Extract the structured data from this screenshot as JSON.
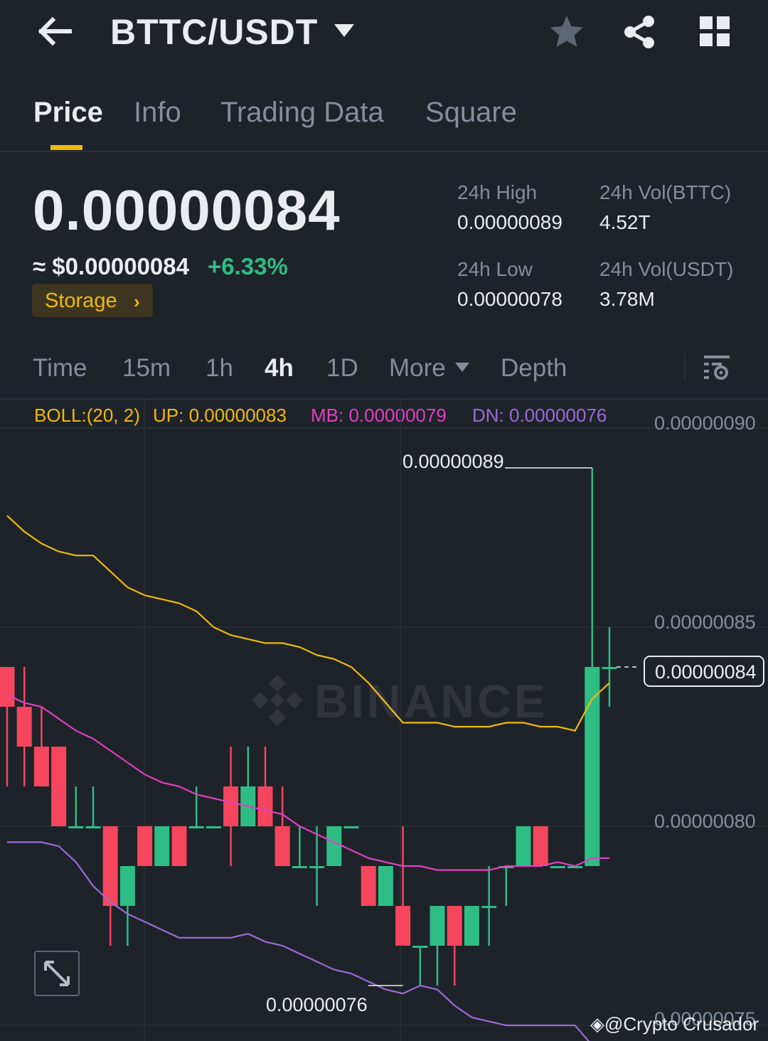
{
  "header": {
    "pair": "BTTC/USDT"
  },
  "tabs": [
    {
      "label": "Price",
      "active": true
    },
    {
      "label": "Info",
      "active": false
    },
    {
      "label": "Trading Data",
      "active": false
    },
    {
      "label": "Square",
      "active": false
    }
  ],
  "ticker": {
    "last_price": "0.00000084",
    "usd_price": "≈ $0.00000084",
    "change": "+6.33%",
    "tag": "Storage",
    "high_label": "24h High",
    "high": "0.00000089",
    "low_label": "24h Low",
    "low": "0.00000078",
    "vol_base_label": "24h Vol(BTTC)",
    "vol_base": "4.52T",
    "vol_quote_label": "24h Vol(USDT)",
    "vol_quote": "3.78M"
  },
  "intervals": [
    "Time",
    "15m",
    "1h",
    "4h",
    "1D",
    "More",
    "Depth"
  ],
  "active_interval": "4h",
  "indicators": {
    "boll": "BOLL:(20, 2)",
    "up": "UP: 0.00000083",
    "mb": "MB: 0.00000079",
    "dn": "DN: 0.00000076"
  },
  "axis": [
    "0.00000090",
    "0.00000085",
    "0.00000080",
    "0.00000075"
  ],
  "current_price_label": "0.00000084",
  "high_callout": "0.00000089",
  "low_callout": "0.00000076",
  "watermark": "BINANCE",
  "credit": "@Crypto Crusador",
  "colors": {
    "up": "#2ebd85",
    "down": "#f6465d",
    "boll_up": "#f0b90b",
    "boll_mb": "#e040bf",
    "boll_dn": "#9b6bd6",
    "accent": "#f0b90b"
  }
}
